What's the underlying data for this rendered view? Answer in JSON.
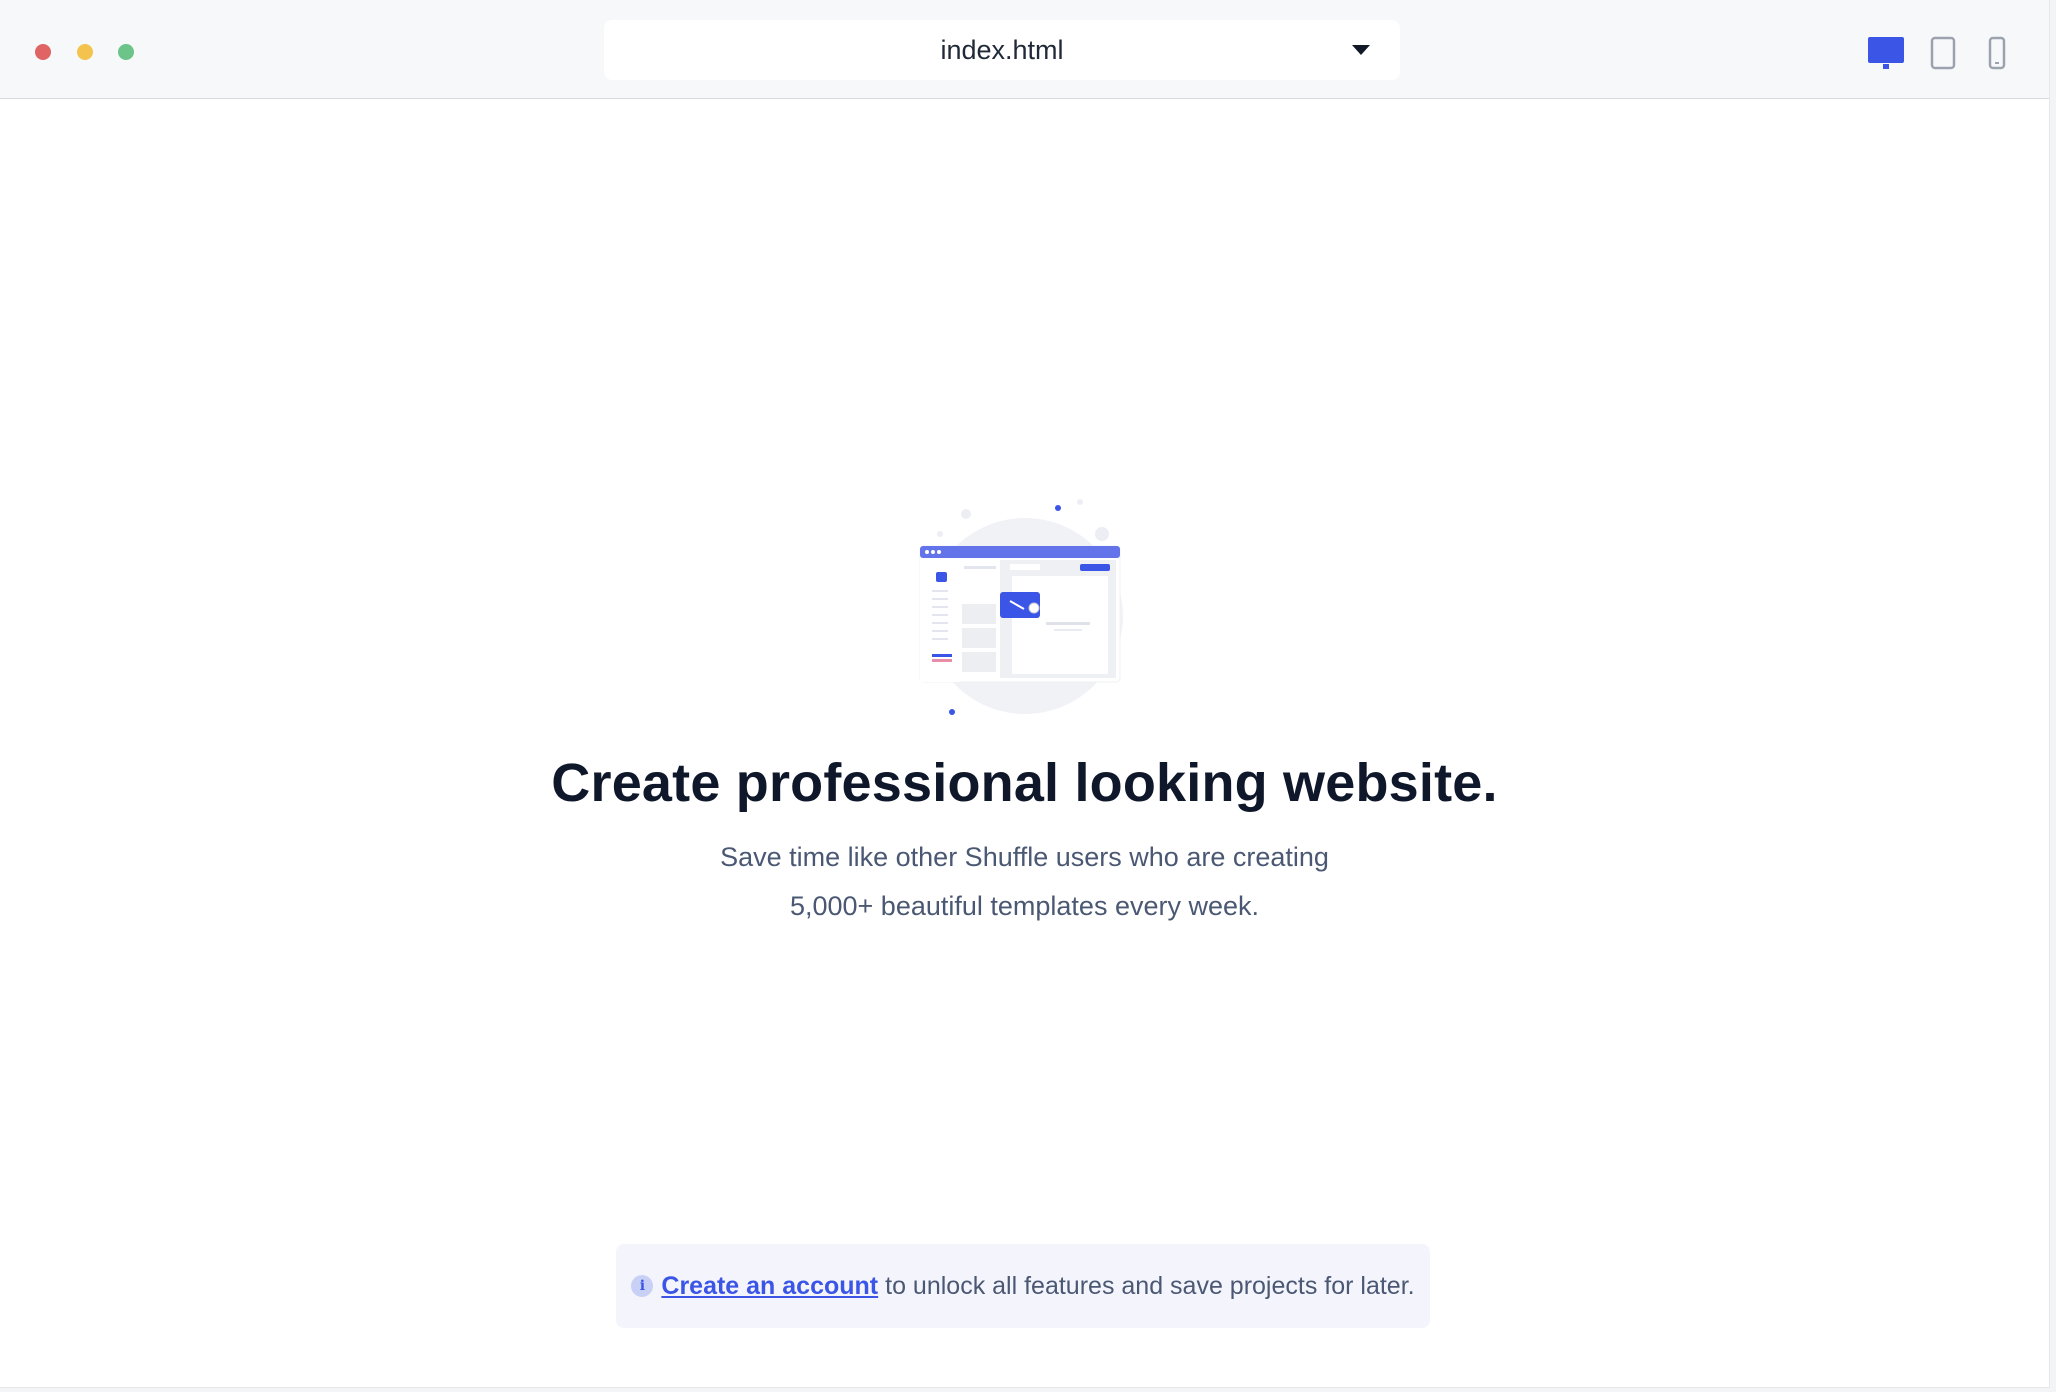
{
  "topbar": {
    "file_name": "index.html",
    "active_device": "desktop"
  },
  "icons": {
    "window_controls": [
      "close-dot",
      "minimize-dot",
      "maximize-dot"
    ],
    "devices": [
      "desktop-icon",
      "tablet-icon",
      "mobile-icon"
    ],
    "info": "info-icon"
  },
  "colors": {
    "accent": "#3b55e6",
    "heading": "#0f172a",
    "body_text": "#4b5874",
    "close": "#e06464",
    "minimize": "#f4c34e",
    "maximize": "#6cc489"
  },
  "hero": {
    "title": "Create professional looking website.",
    "subtitle_line1": "Save time like other Shuffle users who are creating",
    "subtitle_line2": "5,000+ beautiful templates every week."
  },
  "notice": {
    "info_glyph": "i",
    "link_text": "Create an account",
    "text": "to unlock all features and save projects for later."
  }
}
